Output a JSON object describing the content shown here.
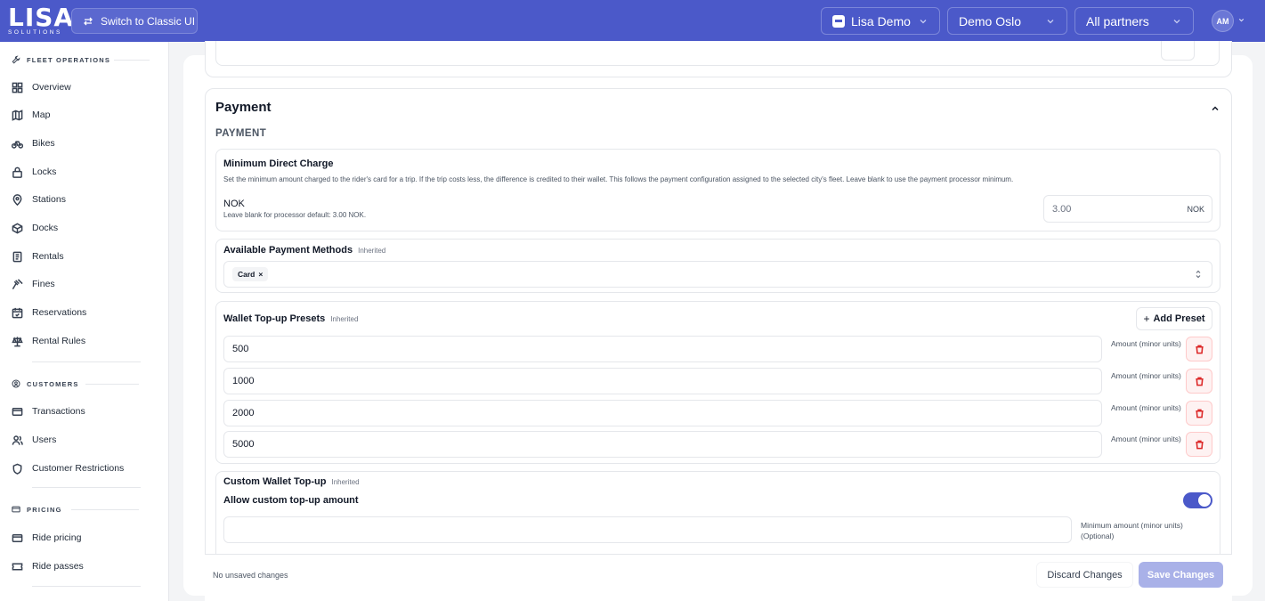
{
  "brand": {
    "logo_main": "LISA",
    "logo_sub": "SOLUTIONS",
    "accent": "#4b59c9"
  },
  "topbar": {
    "classic_btn": "Switch to Classic UI",
    "org_select": "Lisa Demo",
    "city_select": "Demo Oslo",
    "partner_select": "All partners",
    "avatar": "AM"
  },
  "sidebar": {
    "sections": [
      {
        "title": "FLEET OPERATIONS",
        "items": [
          "Overview",
          "Map",
          "Bikes",
          "Locks",
          "Stations",
          "Docks",
          "Rentals",
          "Fines",
          "Reservations",
          "Rental Rules"
        ]
      },
      {
        "title": "CUSTOMERS",
        "items": [
          "Transactions",
          "Users",
          "Customer Restrictions"
        ]
      },
      {
        "title": "PRICING",
        "items": [
          "Ride pricing",
          "Ride passes"
        ]
      }
    ]
  },
  "payment": {
    "title": "Payment",
    "subtitle": "PAYMENT",
    "min_charge": {
      "label": "Minimum Direct Charge",
      "description": "Set the minimum amount charged to the rider's card for a trip. If the trip costs less, the difference is credited to their wallet. This follows the payment configuration assigned to the selected city's fleet. Leave blank to use the payment processor minimum.",
      "currency_label": "NOK",
      "currency_hint": "Leave blank for processor default: 3.00 NOK.",
      "placeholder": "3.00",
      "suffix": "NOK"
    },
    "methods": {
      "label": "Available Payment Methods",
      "badge": "Inherited",
      "chips": [
        "Card"
      ]
    },
    "presets": {
      "label": "Wallet Top-up Presets",
      "badge": "Inherited",
      "add_label": "Add Preset",
      "amount_label": "Amount (minor units)",
      "values": [
        "500",
        "1000",
        "2000",
        "5000"
      ]
    },
    "custom": {
      "label": "Custom Wallet Top-up",
      "badge": "Inherited",
      "allow_label": "Allow custom top-up amount",
      "allow_enabled": true,
      "min_label": "Minimum amount (minor units) (Optional)"
    }
  },
  "footer": {
    "status": "No unsaved changes",
    "discard": "Discard Changes",
    "save": "Save Changes"
  }
}
